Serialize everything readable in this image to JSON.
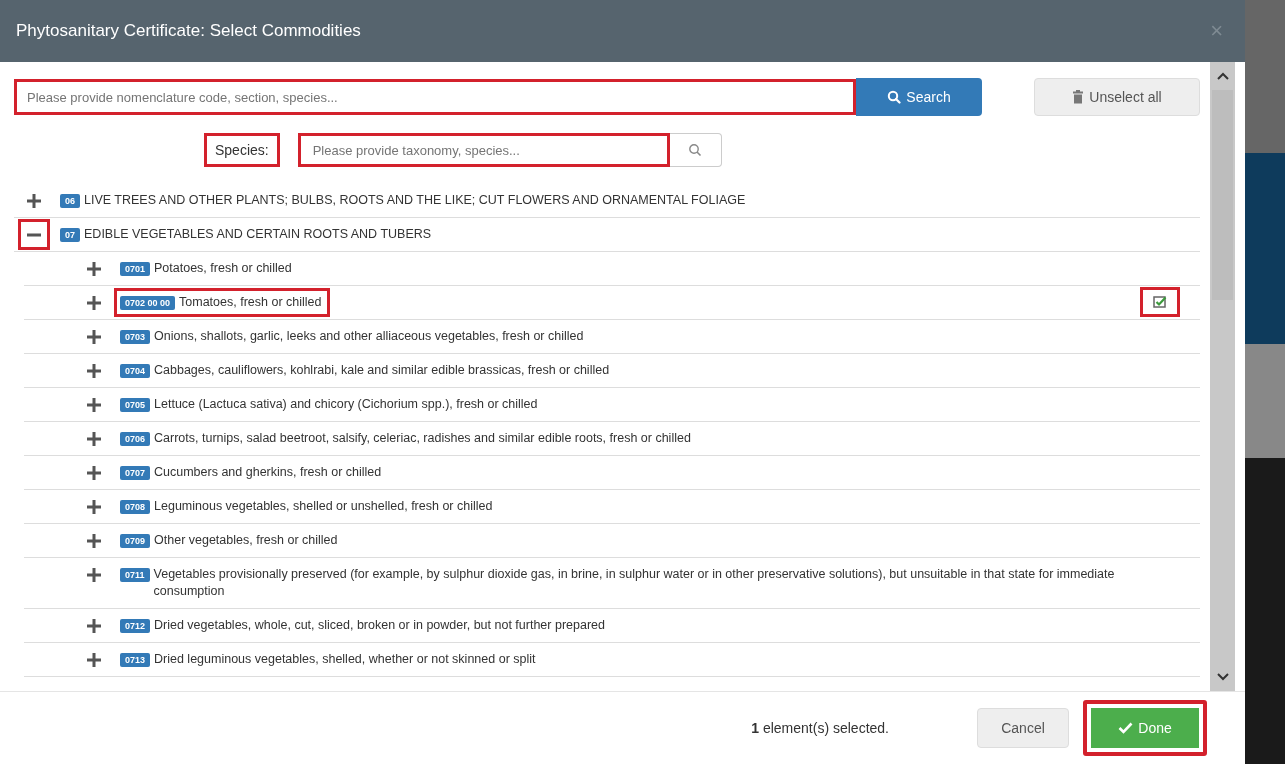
{
  "dialog": {
    "title": "Phytosanitary Certificate: Select Commodities",
    "close": "×"
  },
  "search": {
    "placeholder": "Please provide nomenclature code, section, species...",
    "highlighted": true,
    "button": "Search"
  },
  "unselect_button": "Unselect all",
  "species": {
    "label": "Species:",
    "label_highlighted": true,
    "placeholder": "Please provide taxonomy, species...",
    "highlighted": true
  },
  "tree": [
    {
      "code": "06",
      "label": "LIVE TREES AND OTHER PLANTS; BULBS, ROOTS AND THE LIKE; CUT FLOWERS AND ORNAMENTAL FOLIAGE",
      "expanded": false,
      "toggle_highlighted": false,
      "highlighted": false
    },
    {
      "code": "07",
      "label": "EDIBLE VEGETABLES AND CERTAIN ROOTS AND TUBERS",
      "expanded": true,
      "toggle_highlighted": true,
      "highlighted": false,
      "children": [
        {
          "code": "0701",
          "label": "Potatoes, fresh or chilled",
          "expanded": false,
          "toggle_highlighted": false,
          "highlighted": false
        },
        {
          "code": "0702 00 00",
          "label": "Tomatoes, fresh or chilled",
          "expanded": false,
          "toggle_highlighted": false,
          "highlighted": true,
          "checked": true,
          "checkbox_highlighted": true
        },
        {
          "code": "0703",
          "label": "Onions, shallots, garlic, leeks and other alliaceous vegetables, fresh or chilled",
          "expanded": false,
          "toggle_highlighted": false,
          "highlighted": false
        },
        {
          "code": "0704",
          "label": "Cabbages, cauliflowers, kohlrabi, kale and similar edible brassicas, fresh or chilled",
          "expanded": false,
          "toggle_highlighted": false,
          "highlighted": false
        },
        {
          "code": "0705",
          "label": "Lettuce (Lactuca sativa) and chicory (Cichorium spp.), fresh or chilled",
          "expanded": false,
          "toggle_highlighted": false,
          "highlighted": false
        },
        {
          "code": "0706",
          "label": "Carrots, turnips, salad beetroot, salsify, celeriac, radishes and similar edible roots, fresh or chilled",
          "expanded": false,
          "toggle_highlighted": false,
          "highlighted": false
        },
        {
          "code": "0707",
          "label": "Cucumbers and gherkins, fresh or chilled",
          "expanded": false,
          "toggle_highlighted": false,
          "highlighted": false
        },
        {
          "code": "0708",
          "label": "Leguminous vegetables, shelled or unshelled, fresh or chilled",
          "expanded": false,
          "toggle_highlighted": false,
          "highlighted": false
        },
        {
          "code": "0709",
          "label": "Other vegetables, fresh or chilled",
          "expanded": false,
          "toggle_highlighted": false,
          "highlighted": false
        },
        {
          "code": "0711",
          "label": "Vegetables provisionally preserved (for example, by sulphur dioxide gas, in brine, in sulphur water or in other preservative solutions), but unsuitable in that state for immediate consumption",
          "expanded": false,
          "toggle_highlighted": false,
          "highlighted": false
        },
        {
          "code": "0712",
          "label": "Dried vegetables, whole, cut, sliced, broken or in powder, but not further prepared",
          "expanded": false,
          "toggle_highlighted": false,
          "highlighted": false
        },
        {
          "code": "0713",
          "label": "Dried leguminous vegetables, shelled, whether or not skinned or split",
          "expanded": false,
          "toggle_highlighted": false,
          "highlighted": false
        }
      ]
    }
  ],
  "footer": {
    "status": "**1** element(s) selected.",
    "cancel": "Cancel",
    "done": "Done",
    "done_highlighted": true
  }
}
